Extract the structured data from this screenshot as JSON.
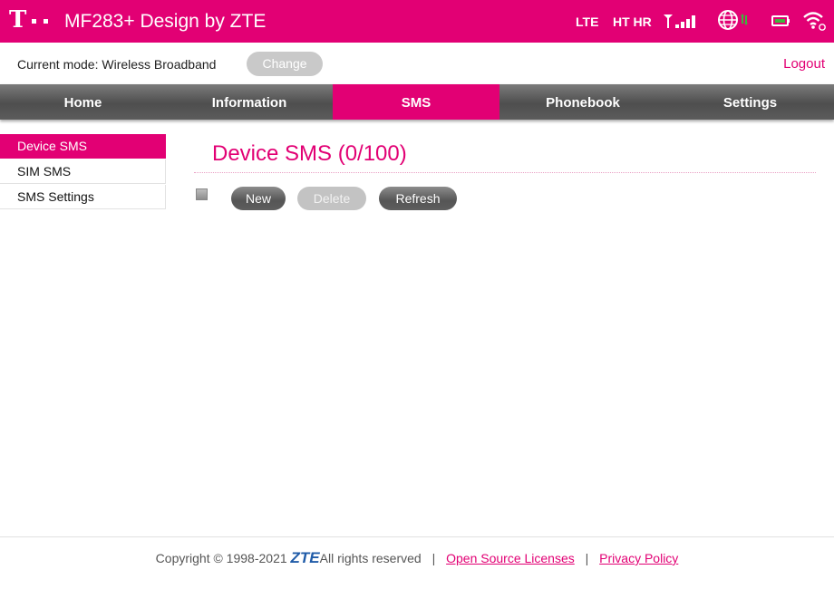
{
  "header": {
    "logo_glyph": "T",
    "title": "MF283+ Design by ZTE",
    "network_type": "LTE",
    "operator": "HT HR",
    "icons": [
      "signal-strength-icon",
      "globe-data-icon",
      "battery-icon",
      "wifi-icon"
    ],
    "brand_color": "#e20074"
  },
  "modebar": {
    "mode_label": "Current mode: Wireless Broadband",
    "change_label": "Change",
    "logout_label": "Logout"
  },
  "nav": {
    "items": [
      {
        "label": "Home"
      },
      {
        "label": "Information"
      },
      {
        "label": "SMS",
        "active": true
      },
      {
        "label": "Phonebook"
      },
      {
        "label": "Settings"
      }
    ]
  },
  "sidebar": {
    "items": [
      {
        "label": "Device SMS",
        "active": true
      },
      {
        "label": "SIM SMS"
      },
      {
        "label": "SMS Settings"
      }
    ]
  },
  "main": {
    "title": "Device SMS (0/100)",
    "new_label": "New",
    "delete_label": "Delete",
    "refresh_label": "Refresh"
  },
  "footer": {
    "copyright": "Copyright © 1998-2021",
    "brand": "ZTE",
    "rights": "All rights reserved",
    "separator": "|",
    "license_link": "Open Source Licenses",
    "privacy_link": "Privacy Policy"
  }
}
